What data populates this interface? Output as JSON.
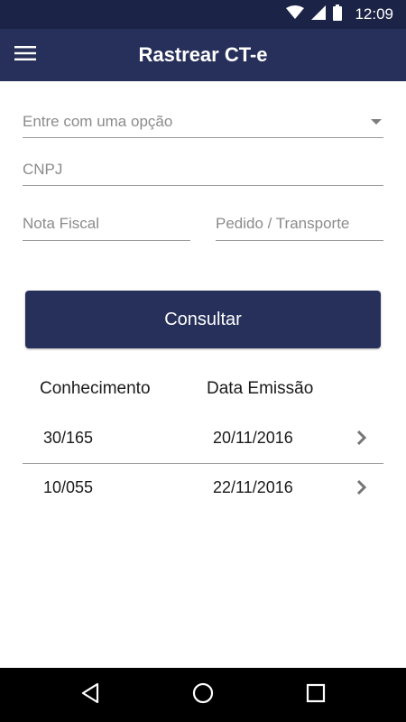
{
  "status_bar": {
    "time": "12:09"
  },
  "app_bar": {
    "title": "Rastrear CT-e"
  },
  "form": {
    "option_placeholder": "Entre com uma opção",
    "cnpj_placeholder": "CNPJ",
    "nota_fiscal_placeholder": "Nota Fiscal",
    "pedido_placeholder": "Pedido / Transporte",
    "consultar_label": "Consultar"
  },
  "results": {
    "headers": [
      "Conhecimento",
      "Data Emissão"
    ],
    "rows": [
      {
        "conhecimento": "30/165",
        "data_emissao": "20/11/2016"
      },
      {
        "conhecimento": "10/055",
        "data_emissao": "22/11/2016"
      }
    ]
  },
  "colors": {
    "primary": "#27305a",
    "status_bar": "#1b2346"
  },
  "icons": [
    "wifi-icon",
    "signal-icon",
    "battery-icon",
    "menu-icon",
    "chevron-right-icon",
    "back-icon",
    "home-icon",
    "recents-icon"
  ]
}
